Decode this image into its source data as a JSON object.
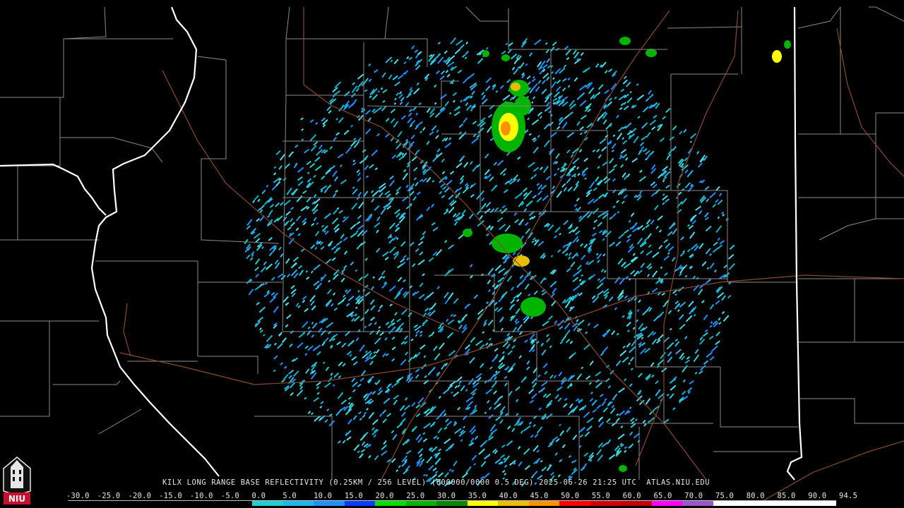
{
  "product": {
    "caption": "KILX LONG RANGE BASE REFLECTIVITY (0.25KM / 256 LEVEL) (000000/0000 0.5 DEG) 2025-06-26 21:25 UTC  ATLAS.NIU.EDU",
    "radar_site": "KILX",
    "date": "2025-06-26",
    "time": "21:25 UTC",
    "source": "ATLAS.NIU.EDU"
  },
  "logo": {
    "text": "NIU",
    "icon": "university-tower-icon",
    "color": "#c8102e"
  },
  "colorbar": {
    "labels": [
      "-30.0",
      "-25.0",
      "-20.0",
      "-15.0",
      "-10.0",
      "-5.0",
      "0.0",
      "5.0",
      "10.0",
      "15.0",
      "20.0",
      "25.0",
      "30.0",
      "35.0",
      "40.0",
      "45.0",
      "50.0",
      "55.0",
      "60.0",
      "65.0",
      "70.0",
      "75.0",
      "80.0",
      "85.0",
      "90.0",
      "94.5"
    ],
    "colors": [
      "#000000",
      "#000000",
      "#000000",
      "#000000",
      "#000000",
      "#000000",
      "#1ed0d0",
      "#1eb8e8",
      "#1e90ff",
      "#0a3cff",
      "#00e000",
      "#00b400",
      "#008a00",
      "#ffff00",
      "#e6c000",
      "#ff9000",
      "#ff0000",
      "#d40000",
      "#c00000",
      "#ff00ff",
      "#9955c9",
      "#ffffff",
      "#ffffff",
      "#ffffff",
      "#ffffff"
    ]
  },
  "map_style": {
    "county_line_color": "#8a8a8a",
    "state_line_color": "#ffffff",
    "highway_color": "#8b4a2a",
    "background": "#000000"
  },
  "echo_palette": [
    "#1ed0d0",
    "#27b6e6",
    "#1e90ff",
    "#12b3c9",
    "#45e0e8"
  ]
}
